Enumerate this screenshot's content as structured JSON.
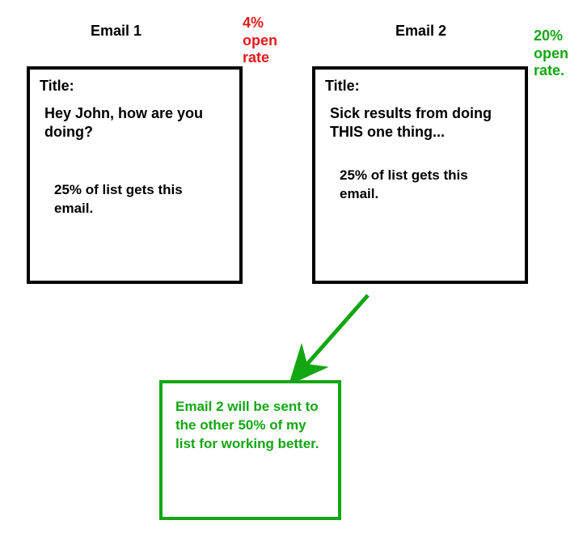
{
  "labels": {
    "title": "Title:"
  },
  "email1": {
    "heading": "Email 1",
    "open_rate": "4% open rate",
    "subject": "Hey John, how are you doing?",
    "list_note": "25% of list gets this email."
  },
  "email2": {
    "heading": "Email 2",
    "open_rate": "20% open rate.",
    "subject": "Sick results from doing THIS one thing...",
    "list_note": "25% of list gets this email."
  },
  "result": {
    "text": "Email 2 will be sent to the other 50% of my list for working better."
  },
  "colors": {
    "arrow": "#12a612",
    "stat_red": "#e31a1c",
    "stat_green": "#12a612",
    "box_border": "#000000",
    "result_border": "#12a612"
  }
}
